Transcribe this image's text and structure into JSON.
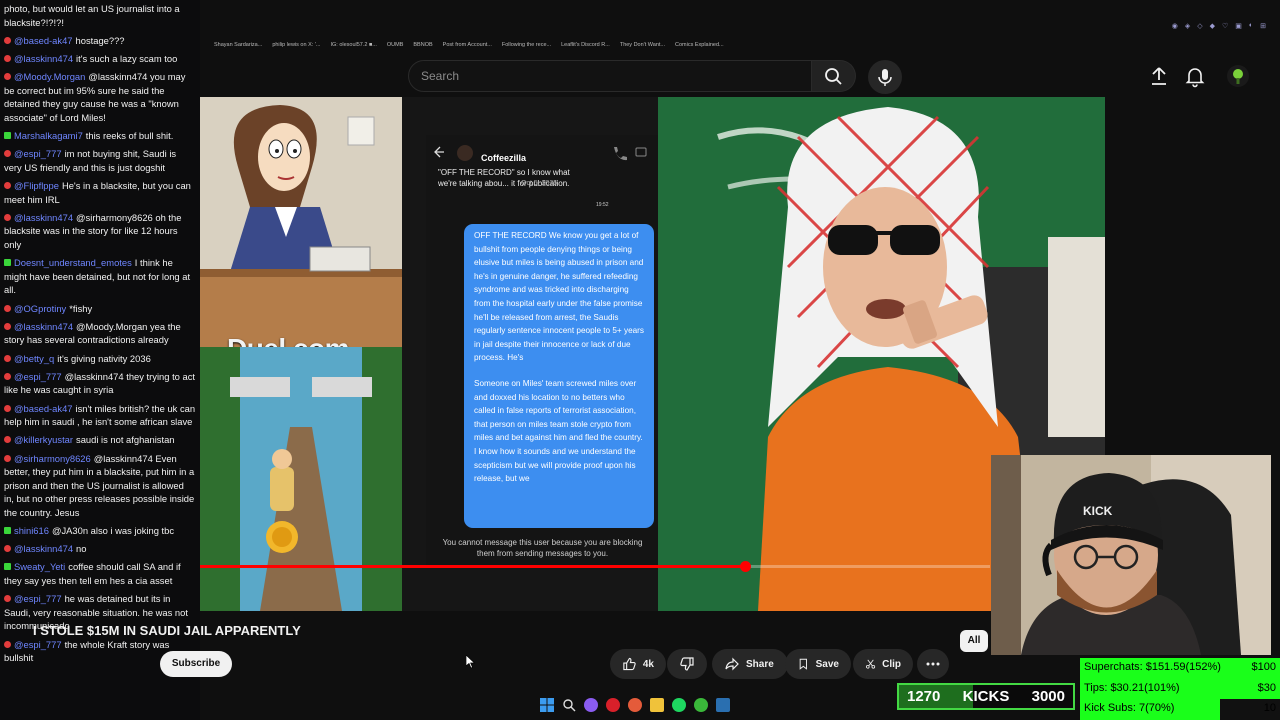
{
  "browser": {
    "bookmarks": [
      "Shayan Sardariza...",
      "philip lewis on X: '...",
      "IG: olesoul57.2 ■...",
      "OUMB",
      "BBNOB",
      "Post from Account...",
      "Following the rece...",
      "Leaflit's Discord R...",
      "They Don't Want...",
      "Comics Explained..."
    ]
  },
  "header": {
    "search_placeholder": "Search"
  },
  "video": {
    "title": "I STOLE $15M IN SAUDI JAIL APPARENTLY",
    "overlay_brand": "Duel.com",
    "progress": 0.69,
    "phone": {
      "contact": "Coffeezilla",
      "first_message": "\"OFF THE RECORD\" so I know what we're talking abou... it for publication.",
      "date": "Oct 5, 2025",
      "time": "19:52",
      "bubble_p1": "OFF THE RECORD We know you get a lot of bullshit from people denying things or being elusive but miles is being abused in prison and he's in genuine danger, he suffered refeeding syndrome and was tricked into discharging from the hospital early under the false promise he'll be released from arrest, the Saudis regularly sentence innocent people to 5+ years in jail despite their innocence or lack of due process. He's",
      "bubble_p2": "Someone on Miles' team screwed miles over and doxxed his location to no betters who called in false reports of terrorist association, that person on miles team stole crypto from miles and bet against him and fled the country. I know how it sounds and we understand the scepticism but we will provide proof upon his release, but we",
      "footer": "You cannot message this user because you are blocking them from sending messages to you."
    }
  },
  "actions": {
    "subscribe": "Subscribe",
    "likes": "4k",
    "share": "Share",
    "save": "Save",
    "clip": "Clip",
    "all_chip": "All"
  },
  "chat": [
    {
      "badge": "none",
      "user": "",
      "text": "photo, but would let an US journalist into a blacksite?!?!?!"
    },
    {
      "badge": "yt",
      "user": "@based-ak47",
      "text": "hostage???"
    },
    {
      "badge": "yt",
      "user": "@lasskinn474",
      "text": "it's such a lazy scam too"
    },
    {
      "badge": "yt",
      "user": "@Moody.Morgan",
      "text": "@lasskinn474 you may be correct but im 95% sure he said the detained they guy cause he was a \"known associate\" of Lord Miles!"
    },
    {
      "badge": "kick",
      "user": "Marshalkagami7",
      "text": "this reeks of bull shit."
    },
    {
      "badge": "yt",
      "user": "@espi_777",
      "text": "im not buying shit, Saudi is very US friendly and this is just dogshit"
    },
    {
      "badge": "yt",
      "user": "@Flipflppe",
      "text": "He's in a blacksite, but you can meet him IRL"
    },
    {
      "badge": "yt",
      "user": "@lasskinn474",
      "text": "@sirharmony8626 oh the blacksite was in the story for like 12 hours only"
    },
    {
      "badge": "kick",
      "user": "Doesnt_understand_emotes",
      "text": "I think he might have been detained, but not for long at all."
    },
    {
      "badge": "yt",
      "user": "@OGprotiny",
      "text": "*fishy"
    },
    {
      "badge": "yt",
      "user": "@lasskinn474",
      "text": "@Moody.Morgan yea the story has several contradictions already"
    },
    {
      "badge": "yt",
      "user": "@betty_q",
      "text": "it's giving nativity 2036"
    },
    {
      "badge": "yt",
      "user": "@espi_777",
      "text": "@lasskinn474 they trying to act like he was caught in syria"
    },
    {
      "badge": "yt",
      "user": "@based-ak47",
      "text": "isn't miles british? the uk can help him in saudi , he isn't some african slave"
    },
    {
      "badge": "yt",
      "user": "@killerkyustar",
      "text": "saudi is not afghanistan"
    },
    {
      "badge": "yt",
      "user": "@sirharmony8626",
      "text": "@lasskinn474 Even better, they put him in a blacksite, put him in a prison and then the US journalist is allowed in, but no other press releases possible inside the country. Jesus"
    },
    {
      "badge": "kick",
      "user": "shini616",
      "text": "@JA30n also i was joking tbc"
    },
    {
      "badge": "yt",
      "user": "@lasskinn474",
      "text": "no"
    },
    {
      "badge": "kick",
      "user": "Sweaty_Yeti",
      "text": "coffee should call SA and if they say yes then tell em hes a cia asset"
    },
    {
      "badge": "yt",
      "user": "@espi_777",
      "text": "he was detained but its in Saudi, very reasonable situation. he was not incommunicado"
    },
    {
      "badge": "yt",
      "user": "@espi_777",
      "text": "the whole Kraft story was bullshit"
    }
  ],
  "widgets": {
    "kicks_current": "1270",
    "kicks_label": "KICKS",
    "kicks_target": "3000",
    "kicks_fraction": 0.423,
    "goals": [
      {
        "label": "Superchats:",
        "value": "$151.59(152%)",
        "target": "$100",
        "fraction": 1.0
      },
      {
        "label": "Tips:",
        "value": "$30.21(101%)",
        "target": "$30",
        "fraction": 1.0
      },
      {
        "label": "Kick Subs:",
        "value": "7(70%)",
        "target": "10",
        "fraction": 0.7
      }
    ]
  },
  "colors": {
    "accent_red": "#ff0000",
    "chat_username": "#6f86ff",
    "kick_green": "#43d943",
    "goal_green": "#1aff1a",
    "bubble_blue": "#3d8ef0"
  }
}
